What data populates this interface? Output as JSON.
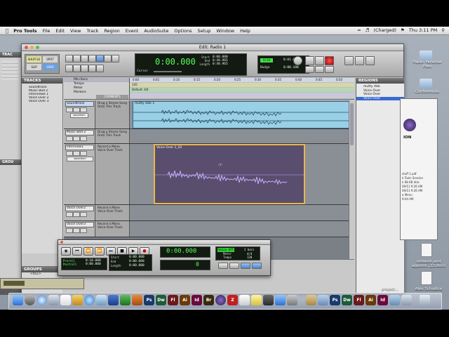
{
  "menubar": {
    "app": "Pro Tools",
    "items": [
      "File",
      "Edit",
      "View",
      "Track",
      "Region",
      "Event",
      "AudioSuite",
      "Options",
      "Setup",
      "Window",
      "Help"
    ],
    "battery": "(Charged)",
    "clock": "Thu 3:11 PM"
  },
  "edit_window": {
    "title": "Edit: Radio 1",
    "counter_main": "0:00.000",
    "sel_start_label": "Start",
    "sel_end_label": "End",
    "sel_length_label": "Length",
    "sel_start": "0:00.000",
    "sel_end": "0:48.965",
    "sel_length": "0:48.965",
    "cursor_label": "Cursor",
    "nudge_label": "Nudge",
    "grid_value": "0:01.000",
    "nudge_value": "0:00.100",
    "mode_shuffle": "SHUFFLE",
    "mode_spot": "SPOT",
    "mode_slip": "SLIP",
    "mode_grid": "GRID"
  },
  "tracks_panel": {
    "header": "TRACKS",
    "items": [
      "Soundtrack",
      "Music Bed 2",
      "Interviewe 1",
      "Voice Over 2",
      "Voice Over 3"
    ]
  },
  "groups_panel": {
    "header": "GROUPS",
    "all": "<ALL>"
  },
  "rulers": {
    "min_secs": "Min:Secs",
    "tempo": "Tempo",
    "meter": "Meter",
    "markers": "Markers",
    "default_meter": "Default: 4/4",
    "tempo_value": "120",
    "ticks": [
      "0:00",
      "0:05",
      "0:10",
      "0:15",
      "0:20",
      "0:25",
      "0:30",
      "0:35",
      "0:40",
      "0:45",
      "0:50"
    ],
    "comments_header": "COMMENTS"
  },
  "tracks": [
    {
      "name": "Soundtrack",
      "comment": "Drag a Stereo Song Onto This Track",
      "mode": "waveform",
      "region": "mutty disk 1"
    },
    {
      "name": "Music Bed 2",
      "comment": "Drag a Stereo Song Onto This Track",
      "mode": "waveform",
      "region": ""
    },
    {
      "name": "Interview1",
      "comment": "Record a Mono Voice Over Track",
      "mode": "waveform",
      "region": "Voice Over 1_02"
    },
    {
      "name": "Voice Over2",
      "comment": "Record a Mono Voice Over Track",
      "mode": "waveform",
      "region": ""
    },
    {
      "name": "Voice Over3",
      "comment": "Record a Mono Voice Over Track",
      "mode": "waveform",
      "region": ""
    }
  ],
  "regions_panel": {
    "header": "REGIONS",
    "items": [
      "mutty disk",
      "Voice Over",
      "Voice Over",
      "Voice Over"
    ]
  },
  "transport": {
    "counter": "0:00.000",
    "secondary": "0",
    "preroll_label": "Preroll",
    "postroll_label": "Postroll",
    "preroll": "0:10.000",
    "postroll": "0:00.000",
    "start_label": "Start",
    "end_label": "End",
    "length_label": "Length",
    "start": "0:00.000",
    "end": "0:00.000",
    "length": "0:00.000",
    "click": "Voice Off",
    "meter_label": "Meter",
    "tempo_label": "Tempo",
    "meter": "4/4",
    "tempo": "120",
    "bars": "2 bars"
  },
  "desktop": {
    "items": [
      "Public Personal Files",
      "Conferences",
      "network and appoint...12.docx",
      "Alex Schudice",
      "project..."
    ]
  },
  "finder_window": {
    "label_top": "ION",
    "lines": [
      "k Tools Session",
      "k 68 KB disk",
      "09/11 9:26 AM",
      "09/11 9:26 AM",
      "a Menu",
      "9:04 AM",
      "stuff 1.pdf"
    ]
  },
  "dock": {
    "apps": [
      "Finder",
      "Dashboard",
      "Safari",
      "Mail",
      "iCal",
      "Photos",
      "iTunes",
      "Preview",
      "Word",
      "Excel",
      "PowerPoint",
      "Ps",
      "Dw",
      "Fl",
      "Ai",
      "Id",
      "Br",
      "Pro Tools",
      "FileZilla",
      "Calendar",
      "Notes",
      "Trash"
    ]
  }
}
